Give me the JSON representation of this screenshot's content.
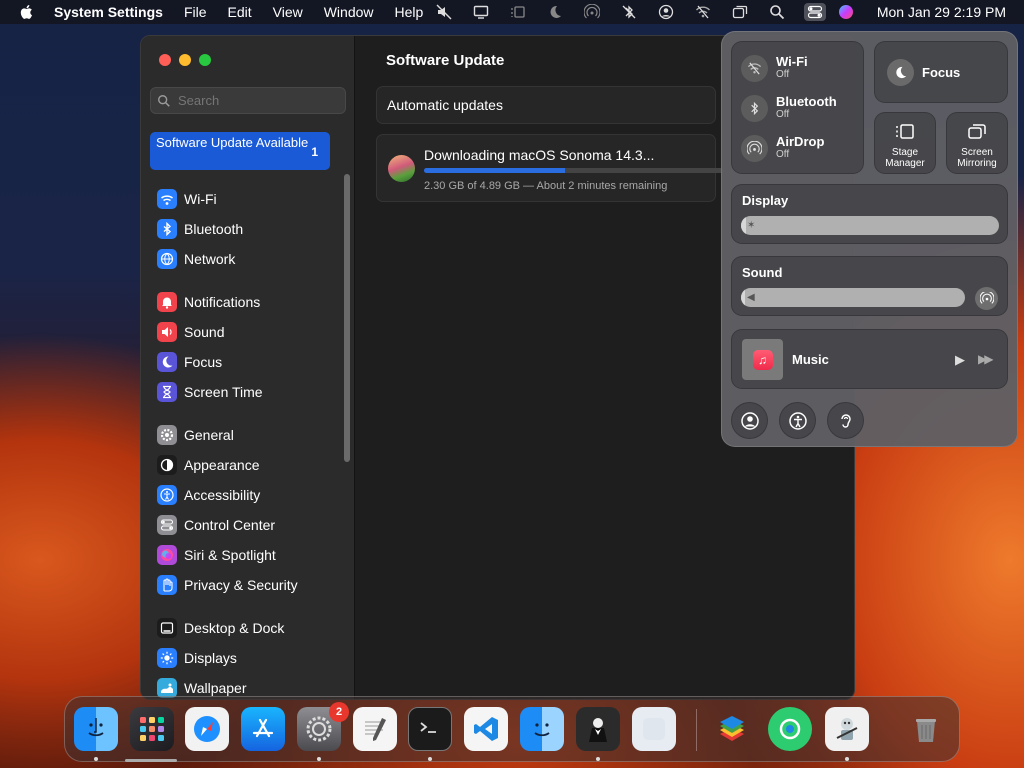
{
  "menubar": {
    "app_name": "System Settings",
    "menus": [
      "File",
      "Edit",
      "View",
      "Window",
      "Help"
    ],
    "clock": "Mon Jan 29  2:19 PM"
  },
  "window": {
    "search_placeholder": "Search",
    "selected_item": {
      "label": "Software Update Available",
      "badge": "1"
    },
    "sidebar_groups": [
      [
        {
          "label": "Wi-Fi",
          "icon": "wifi-icon",
          "color": "#2a7fff"
        },
        {
          "label": "Bluetooth",
          "icon": "bluetooth-icon",
          "color": "#2a7fff"
        },
        {
          "label": "Network",
          "icon": "globe-icon",
          "color": "#2a7fff"
        }
      ],
      [
        {
          "label": "Notifications",
          "icon": "bell-icon",
          "color": "#f0434b"
        },
        {
          "label": "Sound",
          "icon": "speaker-icon",
          "color": "#f0434b"
        },
        {
          "label": "Focus",
          "icon": "moon-icon",
          "color": "#5a55d8"
        },
        {
          "label": "Screen Time",
          "icon": "hourglass-icon",
          "color": "#5a55d8"
        }
      ],
      [
        {
          "label": "General",
          "icon": "gear-icon",
          "color": "#8e8e93"
        },
        {
          "label": "Appearance",
          "icon": "appearance-icon",
          "color": "#1c1c1c"
        },
        {
          "label": "Accessibility",
          "icon": "accessibility-icon",
          "color": "#2a7fff"
        },
        {
          "label": "Control Center",
          "icon": "toggles-icon",
          "color": "#8e8e93"
        },
        {
          "label": "Siri & Spotlight",
          "icon": "siri-icon",
          "color": "#b04ad8"
        },
        {
          "label": "Privacy & Security",
          "icon": "hand-icon",
          "color": "#2a7fff"
        }
      ],
      [
        {
          "label": "Desktop & Dock",
          "icon": "dock-icon",
          "color": "#1c1c1c"
        },
        {
          "label": "Displays",
          "icon": "sun-icon",
          "color": "#2a7fff"
        },
        {
          "label": "Wallpaper",
          "icon": "wallpaper-icon",
          "color": "#35aadc"
        }
      ]
    ],
    "main": {
      "title": "Software Update",
      "automatic_updates": "Automatic updates",
      "download_title": "Downloading macOS Sonoma 14.3...",
      "download_progress": 0.47,
      "download_status": "2.30 GB of 4.89 GB — About 2 minutes remaining"
    }
  },
  "control_center": {
    "wifi": {
      "label": "Wi-Fi",
      "status": "Off"
    },
    "bluetooth": {
      "label": "Bluetooth",
      "status": "Off"
    },
    "airdrop": {
      "label": "AirDrop",
      "status": "Off"
    },
    "focus": "Focus",
    "stage_manager": "Stage Manager",
    "screen_mirroring": "Screen Mirroring",
    "display": {
      "label": "Display",
      "level": 0.02
    },
    "sound": {
      "label": "Sound",
      "level": 0.02
    },
    "music": {
      "label": "Music"
    }
  },
  "dock": {
    "badge_count": "2"
  }
}
